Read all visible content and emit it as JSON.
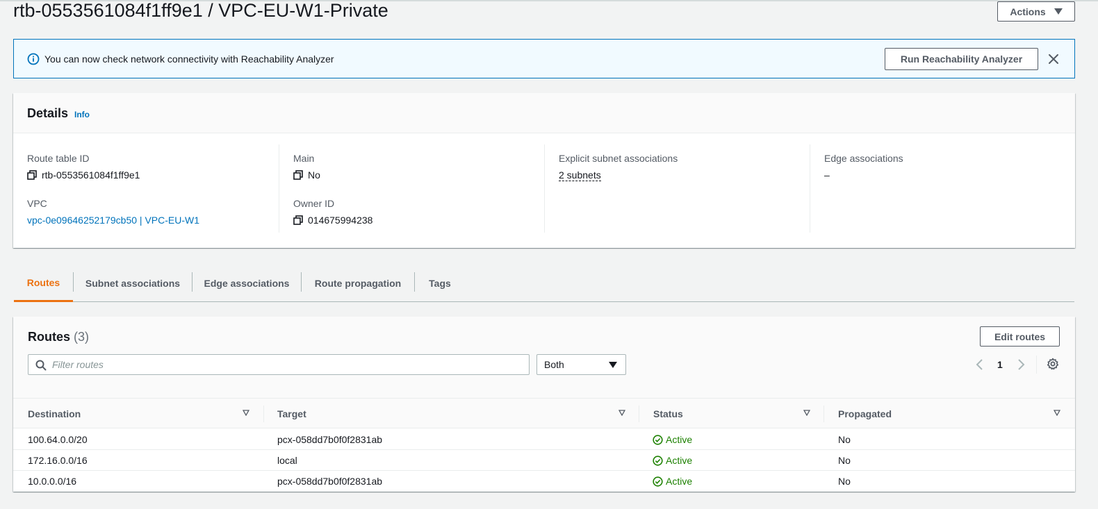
{
  "page": {
    "title": "rtb-0553561084f1ff9e1 / VPC-EU-W1-Private",
    "actions_label": "Actions"
  },
  "flash": {
    "message": "You can now check network connectivity with Reachability Analyzer",
    "button_label": "Run Reachability Analyzer"
  },
  "details": {
    "heading": "Details",
    "info_label": "Info",
    "route_table_id_label": "Route table ID",
    "route_table_id": "rtb-0553561084f1ff9e1",
    "vpc_label": "VPC",
    "vpc_value": "vpc-0e09646252179cb50 | VPC-EU-W1",
    "main_label": "Main",
    "main_value": "No",
    "owner_label": "Owner ID",
    "owner_value": "014675994238",
    "subnet_assoc_label": "Explicit subnet associations",
    "subnet_assoc_value": "2 subnets",
    "edge_assoc_label": "Edge associations",
    "edge_assoc_value": "–"
  },
  "tabs": [
    {
      "label": "Routes"
    },
    {
      "label": "Subnet associations"
    },
    {
      "label": "Edge associations"
    },
    {
      "label": "Route propagation"
    },
    {
      "label": "Tags"
    }
  ],
  "routes": {
    "title": "Routes",
    "count": "(3)",
    "edit_label": "Edit routes",
    "filter_placeholder": "Filter routes",
    "select_value": "Both",
    "page_number": "1",
    "columns": [
      "Destination",
      "Target",
      "Status",
      "Propagated"
    ],
    "rows": [
      {
        "destination": "100.64.0.0/20",
        "target": "pcx-058dd7b0f0f2831ab",
        "status": "Active",
        "propagated": "No"
      },
      {
        "destination": "172.16.0.0/16",
        "target": "local",
        "status": "Active",
        "propagated": "No"
      },
      {
        "destination": "10.0.0.0/16",
        "target": "pcx-058dd7b0f0f2831ab",
        "status": "Active",
        "propagated": "No"
      }
    ]
  },
  "colors": {
    "accent": "#ec7211",
    "link": "#0073bb",
    "success": "#1d8102"
  }
}
